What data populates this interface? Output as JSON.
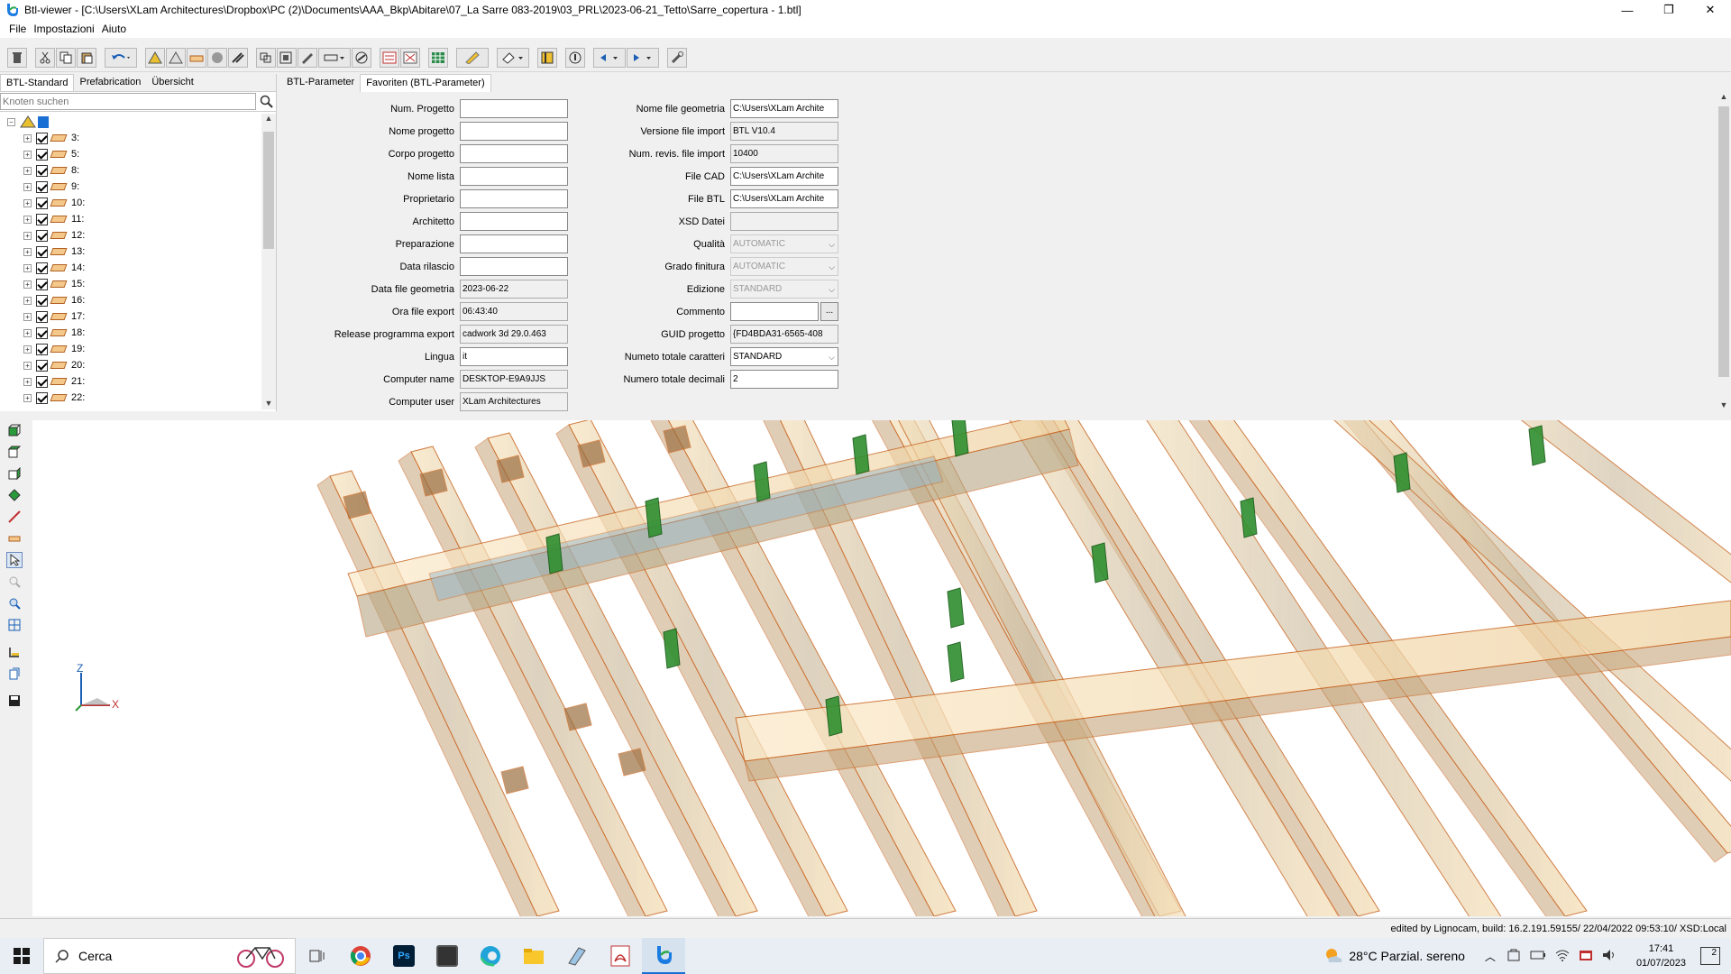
{
  "window": {
    "title": "Btl-viewer - [C:\\Users\\XLam Architectures\\Dropbox\\PC (2)\\Documents\\AAA_Bkp\\Abitare\\07_La Sarre 083-2019\\03_PRL\\2023-06-21_Tetto\\Sarre_copertura - 1.btl]",
    "buttons": {
      "minimize": "—",
      "restore": "❐",
      "close": "✕"
    }
  },
  "menu": {
    "file": "File",
    "settings": "Impostazioni",
    "help": "Aiuto"
  },
  "left": {
    "tabs": [
      "BTL-Standard",
      "Prefabrication",
      "Übersicht"
    ],
    "search_placeholder": "Knoten suchen",
    "nodes": [
      "3:",
      "5:",
      "8:",
      "9:",
      "10:",
      "11:",
      "12:",
      "13:",
      "14:",
      "15:",
      "16:",
      "17:",
      "18:",
      "19:",
      "20:",
      "21:",
      "22:"
    ]
  },
  "right": {
    "tabs": [
      "BTL-Parameter",
      "Favoriten (BTL-Parameter)"
    ],
    "left_fields": [
      {
        "label": "Num. Progetto",
        "value": ""
      },
      {
        "label": "Nome progetto",
        "value": ""
      },
      {
        "label": "Corpo progetto",
        "value": ""
      },
      {
        "label": "Nome lista",
        "value": ""
      },
      {
        "label": "Proprietario",
        "value": ""
      },
      {
        "label": "Architetto",
        "value": ""
      },
      {
        "label": "Preparazione",
        "value": ""
      },
      {
        "label": "Data rilascio",
        "value": ""
      },
      {
        "label": "Data file geometria",
        "value": "2023-06-22"
      },
      {
        "label": "Ora file export",
        "value": "06:43:40"
      },
      {
        "label": "Release programma export",
        "value": "cadwork 3d 29.0.463"
      },
      {
        "label": "Lingua",
        "value": "it"
      },
      {
        "label": "Computer name",
        "value": "DESKTOP-E9A9JJS"
      },
      {
        "label": "Computer user",
        "value": "XLam Architectures"
      }
    ],
    "right_fields": [
      {
        "label": "Nome file geometria",
        "value": "C:\\Users\\XLam Archite"
      },
      {
        "label": "Versione file import",
        "value": "BTL V10.4"
      },
      {
        "label": "Num. revis. file import",
        "value": "10400"
      },
      {
        "label": "File CAD",
        "value": "C:\\Users\\XLam Archite"
      },
      {
        "label": "File BTL",
        "value": "C:\\Users\\XLam Archite"
      },
      {
        "label": "XSD Datei",
        "value": ""
      },
      {
        "label": "Qualità",
        "value": "AUTOMATIC"
      },
      {
        "label": "Grado finitura",
        "value": "AUTOMATIC"
      },
      {
        "label": "Edizione",
        "value": "STANDARD"
      },
      {
        "label": "Commento",
        "value": ""
      },
      {
        "label": "GUID progetto",
        "value": "{FD4BDA31-6565-408"
      },
      {
        "label": "Numeto totale caratteri",
        "value": "STANDARD"
      },
      {
        "label": "Numero totale decimali",
        "value": "2"
      }
    ],
    "comment_button": "..."
  },
  "viewport": {
    "axis_z": "Z",
    "axis_x": "X"
  },
  "status": {
    "text": "edited by Lignocam, build: 16.2.191.59155/ 22/04/2022 09:53:10/ XSD:Local"
  },
  "taskbar": {
    "search": "Cerca",
    "weather": "28°C  Parzial. sereno",
    "time": "17:41",
    "date": "01/07/2023",
    "notifications": "2"
  },
  "colors": {
    "beam": "#f3d9a8",
    "beam_edge": "#c8641e",
    "connector": "#2f8f2f"
  }
}
